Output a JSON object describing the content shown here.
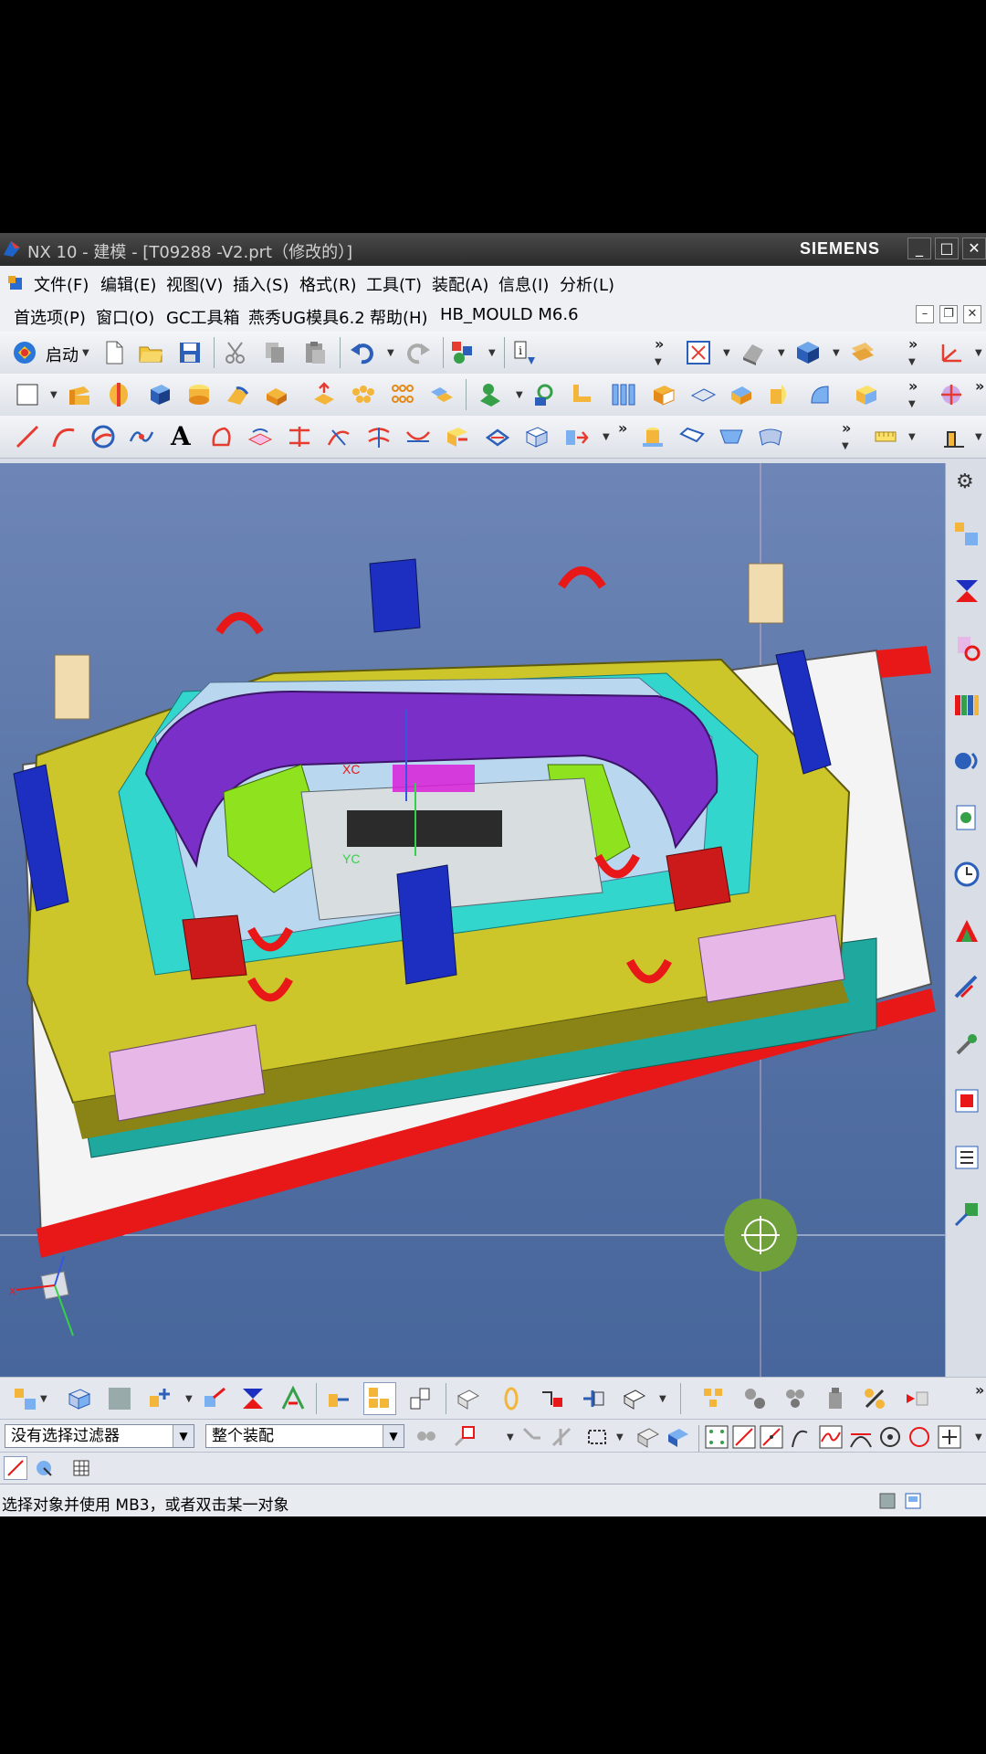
{
  "window": {
    "title": "NX 10 - 建模 - [T09288 -V2.prt（修改的）]",
    "brand": "SIEMENS",
    "minimize": "_",
    "maximize": "□",
    "close": "✕"
  },
  "menu_row1": [
    "文件(F)",
    "编辑(E)",
    "视图(V)",
    "插入(S)",
    "格式(R)",
    "工具(T)",
    "装配(A)",
    "信息(I)",
    "分析(L)"
  ],
  "menu_row2": [
    "首选项(P)",
    "窗口(O)",
    "GC工具箱",
    "燕秀UG模具6.2",
    "帮助(H)",
    "HB_MOULD M6.6"
  ],
  "toolbar1": {
    "start_label": "启动"
  },
  "viewport": {
    "xc_label": "XC",
    "yc_label": "YC",
    "triad_x": "X"
  },
  "filter_bar": {
    "selection_filter": "没有选择过滤器",
    "assembly_scope": "整个装配"
  },
  "status": {
    "message": "选择对象并使用 MB3，或者双击某一对象"
  },
  "colors": {
    "viewport_top": "#6d86b7",
    "viewport_bottom": "#47669b",
    "mold_yellow": "#c9c62a",
    "mold_purple": "#7a2fc8",
    "mold_cyan": "#2fd9d0",
    "plate_red": "#e01818",
    "crosshair_green": "#6fa03a"
  }
}
